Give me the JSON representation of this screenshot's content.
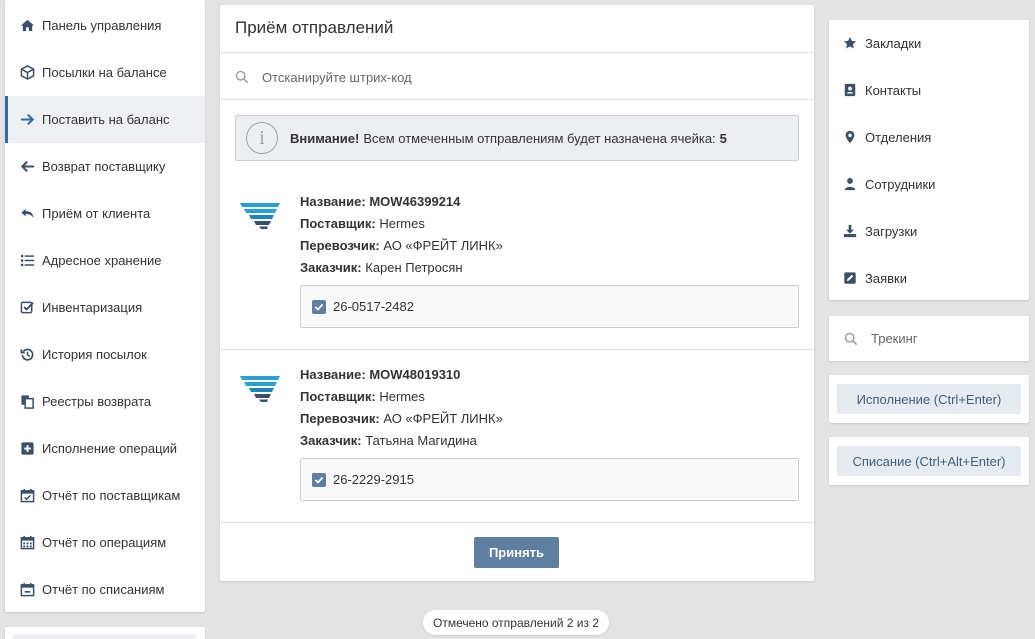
{
  "sidebar": {
    "items": [
      {
        "label": "Панель управления",
        "icon": "home-icon"
      },
      {
        "label": "Посылки на балансе",
        "icon": "box-icon"
      },
      {
        "label": "Поставить на баланс",
        "icon": "arrow-right-icon",
        "active": true
      },
      {
        "label": "Возврат поставщику",
        "icon": "arrow-left-icon"
      },
      {
        "label": "Приём от клиента",
        "icon": "reply-icon"
      },
      {
        "label": "Адресное хранение",
        "icon": "list-icon"
      },
      {
        "label": "Инвентаризация",
        "icon": "check-square-icon"
      },
      {
        "label": "История посылок",
        "icon": "history-icon"
      },
      {
        "label": "Реестры возврата",
        "icon": "copy-icon"
      },
      {
        "label": "Исполнение операций",
        "icon": "plus-square-icon"
      },
      {
        "label": "Отчёт по поставщикам",
        "icon": "calendar-check-icon"
      },
      {
        "label": "Отчёт по операциям",
        "icon": "calendar-icon"
      },
      {
        "label": "Отчёт по списаниям",
        "icon": "calendar-minus-icon"
      }
    ]
  },
  "main": {
    "title": "Приём отправлений",
    "scan_placeholder": "Отсканируйте штрих-код",
    "notice": {
      "strong": "Внимание!",
      "text": "Всем отмеченным отправлениям будет назначена ячейка:",
      "cell": "5"
    },
    "shipments": [
      {
        "name_label": "Название:",
        "name": "MOW46399214",
        "supplier_label": "Поставщик:",
        "supplier": "Hermes",
        "carrier_label": "Перевозчик:",
        "carrier": "АО «ФРЕЙТ ЛИНК»",
        "customer_label": "Заказчик:",
        "customer": "Карен Петросян",
        "barcode": "26-0517-2482",
        "checked": true
      },
      {
        "name_label": "Название:",
        "name": "MOW48019310",
        "supplier_label": "Поставщик:",
        "supplier": "Hermes",
        "carrier_label": "Перевозчик:",
        "carrier": "АО «ФРЕЙТ ЛИНК»",
        "customer_label": "Заказчик:",
        "customer": "Татьяна Магидина",
        "barcode": "26-2229-2915",
        "checked": true
      }
    ],
    "accept_label": "Принять",
    "counter": "Отмечено отправлений 2 из 2"
  },
  "right": {
    "links": [
      {
        "label": "Закладки",
        "icon": "star-icon"
      },
      {
        "label": "Контакты",
        "icon": "address-book-icon"
      },
      {
        "label": "Отделения",
        "icon": "map-marker-icon"
      },
      {
        "label": "Сотрудники",
        "icon": "user-icon"
      },
      {
        "label": "Загрузки",
        "icon": "download-icon"
      },
      {
        "label": "Заявки",
        "icon": "edit-icon"
      }
    ],
    "tracking_placeholder": "Трекинг",
    "execute_label": "Исполнение (Ctrl+Enter)",
    "writeoff_label": "Списание (Ctrl+Alt+Enter)"
  },
  "colors": {
    "accent": "#2c6ea5",
    "button": "#5f7fa0",
    "icon": "#3a5068",
    "logo": "#2a9fd6"
  }
}
